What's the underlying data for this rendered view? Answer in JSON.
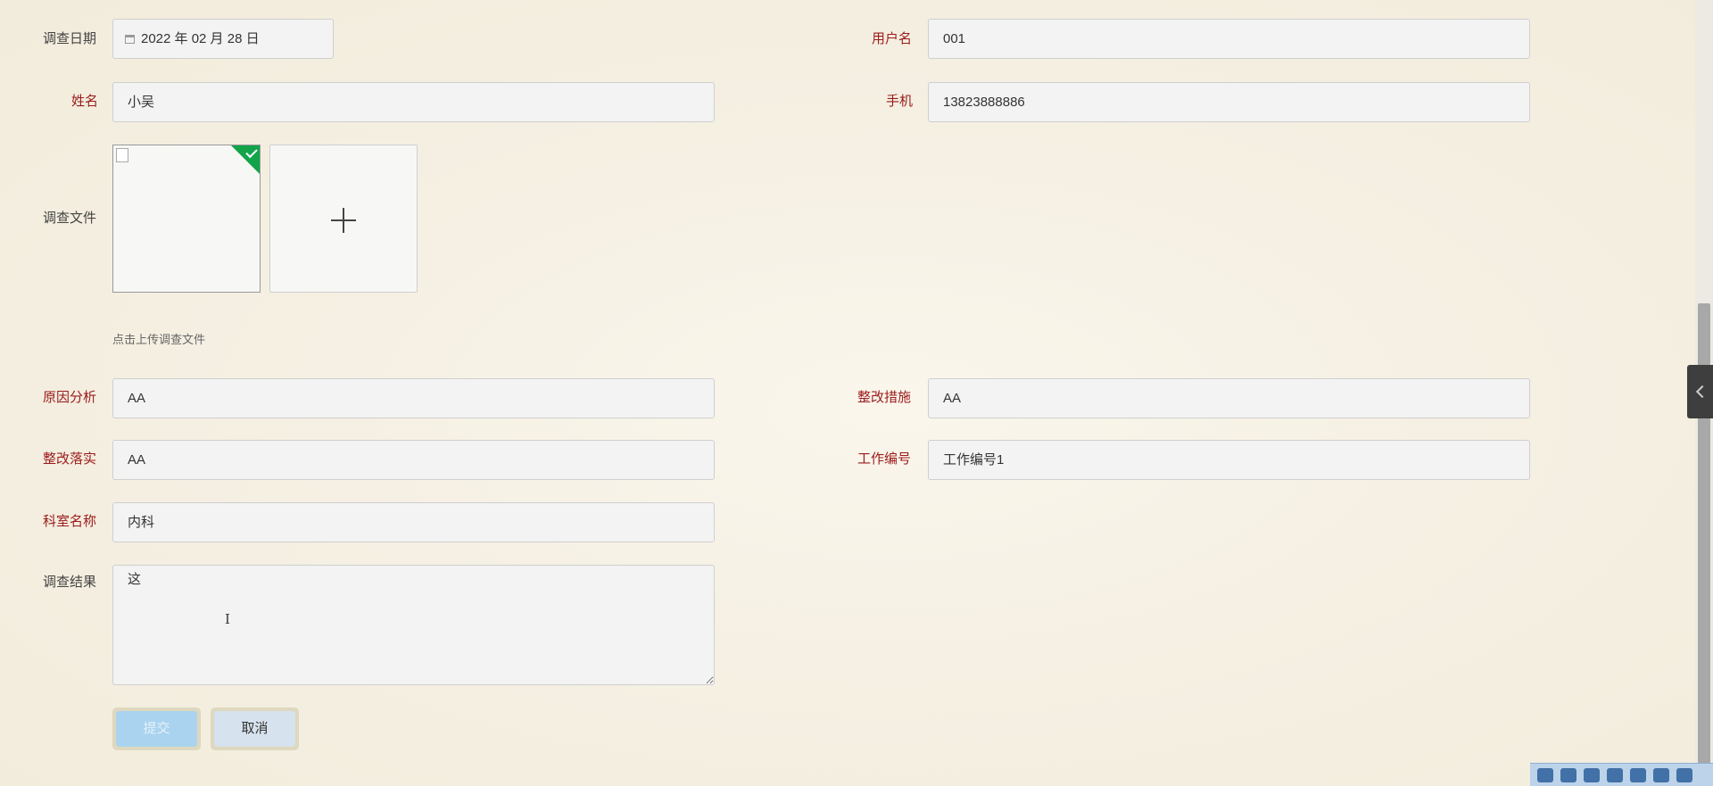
{
  "form": {
    "survey_date": {
      "label": "调查日期",
      "value": "2022 年 02 月 28 日"
    },
    "username": {
      "label": "用户名",
      "value": "001"
    },
    "name": {
      "label": "姓名",
      "value": "小吴"
    },
    "phone": {
      "label": "手机",
      "value": "13823888886"
    },
    "survey_file": {
      "label": "调查文件",
      "hint": "点击上传调查文件"
    },
    "cause_analysis": {
      "label": "原因分析",
      "value": "AA"
    },
    "rectification_measures": {
      "label": "整改措施",
      "value": "AA"
    },
    "rectification_implementation": {
      "label": "整改落实",
      "value": "AA"
    },
    "work_number": {
      "label": "工作编号",
      "value": "工作编号1"
    },
    "department_name": {
      "label": "科室名称",
      "value": "内科"
    },
    "survey_result": {
      "label": "调查结果",
      "value": "这"
    }
  },
  "buttons": {
    "submit": "提交",
    "cancel": "取消"
  },
  "colors": {
    "required_label": "#9a1b1b",
    "upload_success": "#12a44a",
    "submit_bg": "#aad3ef",
    "cancel_bg": "#d6e2ee"
  },
  "icons": {
    "date": "calendar-icon",
    "upload_status": "check-icon",
    "add": "plus-icon",
    "side_toggle": "chevron-left-icon"
  }
}
